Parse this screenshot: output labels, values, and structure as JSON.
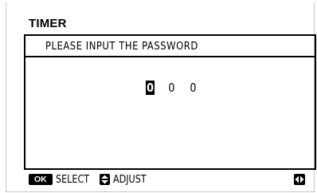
{
  "screen": {
    "title": "TIMER",
    "prompt": "PLEASE INPUT THE PASSWORD",
    "password_digits": [
      {
        "value": "0",
        "selected": true
      },
      {
        "value": "0",
        "selected": false
      },
      {
        "value": "0",
        "selected": false
      }
    ]
  },
  "footer": {
    "ok_key": "OK",
    "select_label": "SELECT",
    "adjust_label": "ADJUST"
  },
  "icons": {
    "updown": "up-down-arrow-icon",
    "leftright": "left-right-arrow-icon"
  }
}
